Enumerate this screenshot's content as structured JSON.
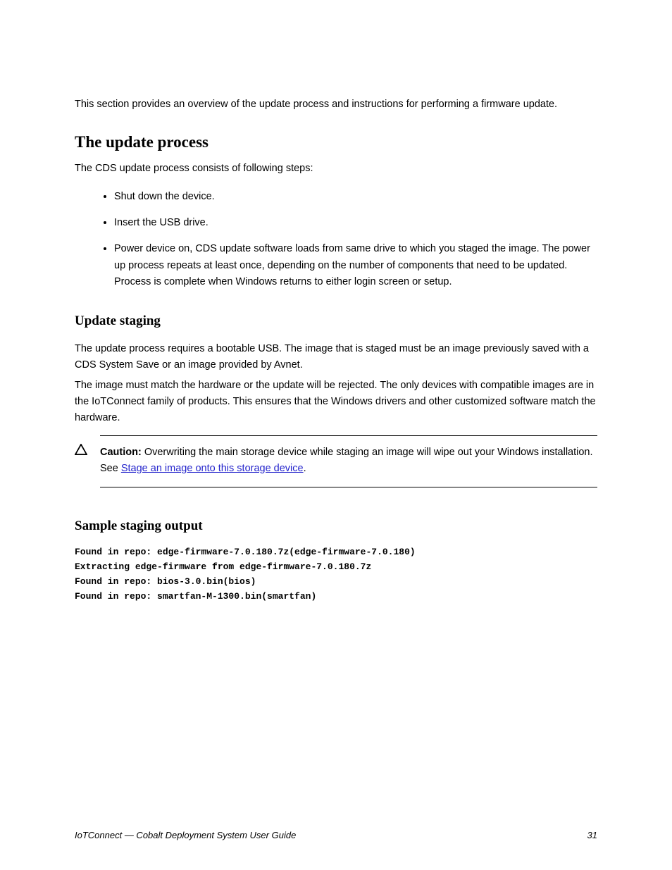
{
  "intro": "This section provides an overview of the update process and instructions for performing a firmware update.",
  "heading1": "The update process",
  "h1_para": "The CDS update process consists of following steps:",
  "bullets": [
    "Shut down the device.",
    "Insert the USB drive.",
    "Power device on, CDS update software loads from same drive to which you staged the image. The power up process repeats at least once, depending on the number of components that need to be updated. Process is complete when Windows returns to either login screen or setup."
  ],
  "heading2_1": "Update staging",
  "h2_1_para1": "The update process requires a bootable USB. The image that is staged must be an image previously saved with a CDS System Save or an image provided by Avnet.",
  "h2_1_para2": "The image must match the hardware or the update will be rejected. The only devices with compatible images are in the IoTConnect family of products. This ensures that the Windows drivers and other customized software match the hardware.",
  "caution_label": "Caution: ",
  "caution_text_pre": "Overwriting the main storage device while staging an image will wipe out your Windows installation. See ",
  "caution_link": "Stage an image onto this storage device",
  "caution_text_post": ".",
  "heading2_2": "Sample staging output",
  "code_lines": [
    "Found in repo: edge-firmware-7.0.180.7z(edge-firmware-7.0.180)",
    "Extracting edge-firmware from edge-firmware-7.0.180.7z",
    "Found in repo: bios-3.0.bin(bios)",
    "Found in repo: smartfan-M-1300.bin(smartfan)"
  ],
  "footer_title": "IoTConnect — Cobalt Deployment System User Guide",
  "footer_page": "31"
}
